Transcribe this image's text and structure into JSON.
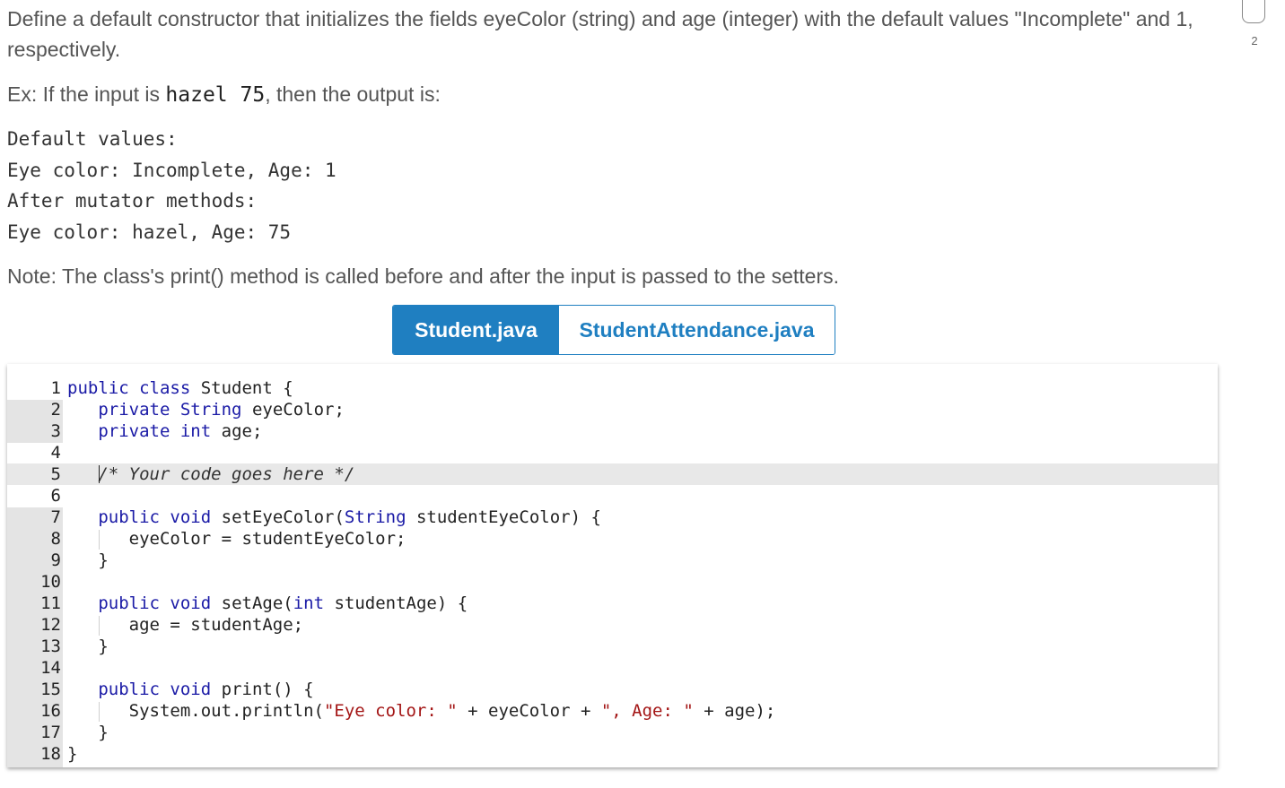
{
  "instructions": {
    "paragraph1": "Define a default constructor that initializes the fields eyeColor (string) and age (integer) with the default values \"Incomplete\" and 1, respectively.",
    "example_prefix": "Ex: If the input is ",
    "example_input": "hazel 75",
    "example_suffix": ", then the output is:",
    "output_lines": [
      "Default values:",
      "Eye color: Incomplete, Age: 1",
      "After mutator methods:",
      "Eye color: hazel, Age: 75"
    ],
    "note": "Note: The class's print() method is called before and after the input is passed to the setters."
  },
  "badge": {
    "count": "2"
  },
  "tabs": [
    {
      "label": "Student.java",
      "active": true
    },
    {
      "label": "StudentAttendance.java",
      "active": false
    }
  ],
  "editor": {
    "active_line": 5,
    "line_numbers": [
      "1",
      "2",
      "3",
      "4",
      "5",
      "6",
      "7",
      "8",
      "9",
      "10",
      "11",
      "12",
      "13",
      "14",
      "15",
      "16",
      "17",
      "18"
    ],
    "tokens": {
      "public": "public",
      "class": "class",
      "private": "private",
      "String": "String",
      "int": "int",
      "void": "void",
      "l1_name": " Student {",
      "l2_rest": " eyeColor;",
      "l3_rest": " age;",
      "l5_comment": "/* Your code goes here */",
      "l7_a": " setEyeColor(",
      "l7_b": " studentEyeColor) {",
      "l8": "eyeColor = studentEyeColor;",
      "brace": "}",
      "l11_a": " setAge(",
      "l11_b": " studentAge) {",
      "l12": "age = studentAge;",
      "l15_rest": " print() {",
      "l16_a": "System.out.println(",
      "l16_s1": "\"Eye color: \"",
      "l16_b": " + eyeColor + ",
      "l16_s2": "\", Age: \"",
      "l16_c": " + age);"
    }
  }
}
